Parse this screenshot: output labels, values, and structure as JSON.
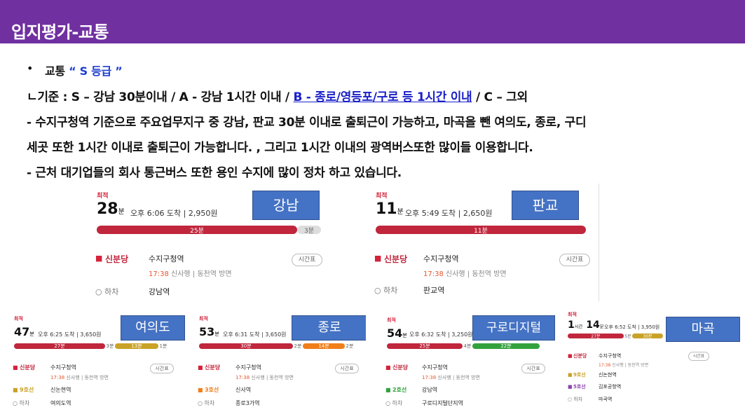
{
  "header": {
    "title": "입지평가-교통"
  },
  "intro": {
    "bullet": "•",
    "traffic_label": "교통 ",
    "grade": "“ S 등급 ”",
    "criteria_prefix": "ㄴ기준 : S – 강남 30분이내 / A - 강남 1시간 이내 / ",
    "criteria_link": "B - 종로/영등포/구로 등 1시간 이내",
    "criteria_suffix": " / C – 그외",
    "para1": "- 수지구청역 기준으로  주요업무지구 중 강남, 판교 30분 이내로 출퇴근이 가능하고, 마곡을 뺀 여의도, 종로, 구디",
    "para2": "세곳 또한 1시간 이내로 출퇴근이 가능합니다. , 그리고 1시간 이내의 광역버스또한 많이들 이용합니다.",
    "para3": "- 근처 대기업들의 회사 통근버스 또한 용인 수지에 많이 정차 하고 있습니다."
  },
  "routes": [
    {
      "badge": "강남",
      "fastest": "최적",
      "minutes": "28",
      "unit": "분",
      "arrival": "오후 6:06 도착",
      "fare": "2,950원",
      "segments": [
        "25분",
        "3분"
      ],
      "origin_line": "신분당",
      "origin_station": "수지구청역",
      "depart_time": "17:38",
      "depart_detail": "신사행 | 동천역 방면",
      "schedule": "시간표",
      "transfer_line": "",
      "transfer_station": "",
      "alight_label": "하차",
      "dest_station": "강남역"
    },
    {
      "badge": "판교",
      "fastest": "최적",
      "minutes": "11",
      "unit": "분",
      "arrival": "오후 5:49 도착",
      "fare": "2,650원",
      "segments": [
        "11분"
      ],
      "origin_line": "신분당",
      "origin_station": "수지구청역",
      "depart_time": "17:38",
      "depart_detail": "신사행 | 동천역 방면",
      "schedule": "시간표",
      "transfer_line": "",
      "transfer_station": "",
      "alight_label": "하차",
      "dest_station": "판교역"
    },
    {
      "badge": "여의도",
      "fastest": "최적",
      "minutes": "47",
      "unit": "분",
      "arrival": "오후 6:25 도착",
      "fare": "3,650원",
      "segments": [
        "27분",
        "3분",
        "13분",
        "1분"
      ],
      "origin_line": "신분당",
      "origin_station": "수지구청역",
      "depart_time": "17:38",
      "depart_detail": "신사행 | 동천역 방면",
      "schedule": "시간표",
      "transfer_line": "9호선",
      "transfer_station": "신논현역",
      "alight_label": "하차",
      "dest_station": "여의도역"
    },
    {
      "badge": "종로",
      "fastest": "최적",
      "minutes": "53",
      "unit": "분",
      "arrival": "오후 6:31 도착",
      "fare": "3,650원",
      "segments": [
        "30분",
        "2분",
        "14분",
        "2분"
      ],
      "origin_line": "신분당",
      "origin_station": "수지구청역",
      "depart_time": "17:38",
      "depart_detail": "신사행 | 동천역 방면",
      "schedule": "시간표",
      "transfer_line": "3호선",
      "transfer_station": "신사역",
      "alight_label": "하차",
      "dest_station": "종로3가역"
    },
    {
      "badge": "구로디지털",
      "fastest": "최적",
      "minutes": "54",
      "unit": "분",
      "arrival": "오후 6:32 도착",
      "fare": "3,250원",
      "segments": [
        "25분",
        "4분",
        "22분"
      ],
      "origin_line": "신분당",
      "origin_station": "수지구청역",
      "depart_time": "17:38",
      "depart_detail": "신사행 | 동천역 방면",
      "schedule": "시간표",
      "transfer_line": "2호선",
      "transfer_station": "강남역",
      "alight_label": "하차",
      "dest_station": "구로디지털단지역"
    },
    {
      "badge": "마곡",
      "fastest": "최적",
      "hours": "1",
      "hours_unit": "시간",
      "minutes": "14",
      "unit": "분",
      "arrival": "오후 6:52 도착",
      "fare": "3,950원",
      "segments": [
        "27분",
        "5분",
        "30분"
      ],
      "origin_line": "신분당",
      "origin_station": "수지구청역",
      "depart_time": "17:38",
      "depart_detail": "신사행 | 동천역 방면",
      "schedule": "시간표",
      "transfer_line": "9호선",
      "transfer_station": "신논현역",
      "transfer_line2": "5호선",
      "transfer_station2": "김포공항역",
      "alight_label": "하차",
      "dest_station": "마곡역"
    }
  ],
  "colors": {
    "header": "#7030a0",
    "sinbundang": "#c0263c",
    "line9": "#c9a227",
    "line3": "#f07f1a",
    "line2": "#33a23d",
    "line5": "#8e44ad",
    "badge": "#4472c4"
  }
}
